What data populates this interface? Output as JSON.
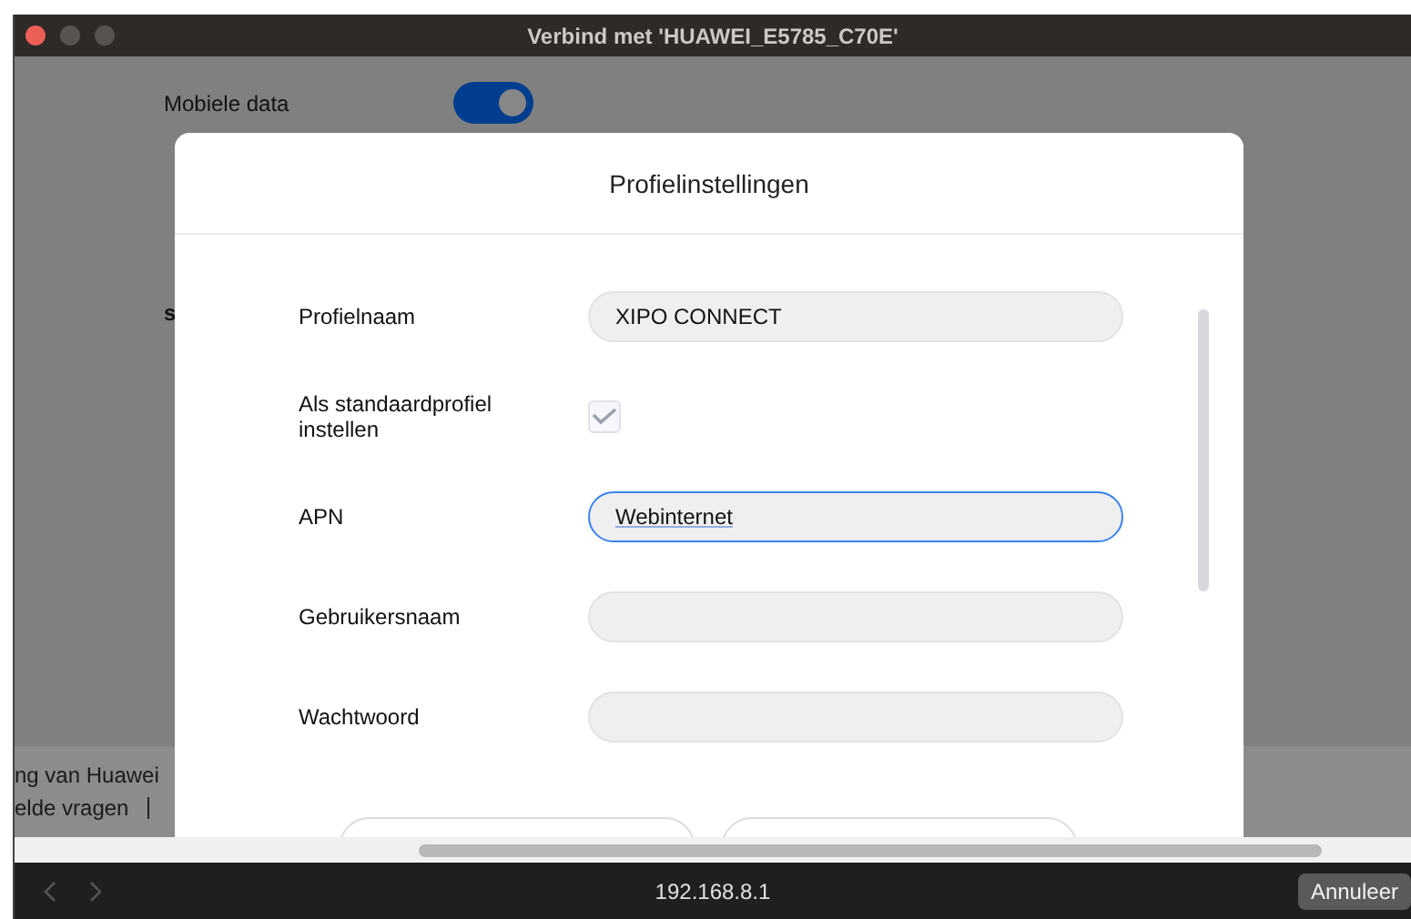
{
  "window": {
    "title": "Verbind met 'HUAWEI_E5785_C70E'"
  },
  "background": {
    "mobile_data": {
      "label": "Mobiele data",
      "on": true
    },
    "fragments": [
      "s"
    ],
    "footer": [
      "ng van Huawei",
      "elde vragen"
    ]
  },
  "dialog": {
    "title": "Profielinstellingen",
    "rows": [
      {
        "kind": "field",
        "label": "Profielnaam",
        "value": "XIPO CONNECT",
        "focused": false
      },
      {
        "kind": "checkbox",
        "label": "Als standaardprofiel instellen",
        "checked": true,
        "disabled": true
      },
      {
        "kind": "field",
        "label": "APN",
        "value": "Webinternet",
        "focused": true
      },
      {
        "kind": "field",
        "label": "Gebruikersnaam",
        "focused": false
      },
      {
        "kind": "field",
        "label": "Wachtwoord",
        "focused": false
      }
    ]
  },
  "bottom_bar": {
    "address": "192.168.8.1",
    "cancel": "Annuleer"
  }
}
